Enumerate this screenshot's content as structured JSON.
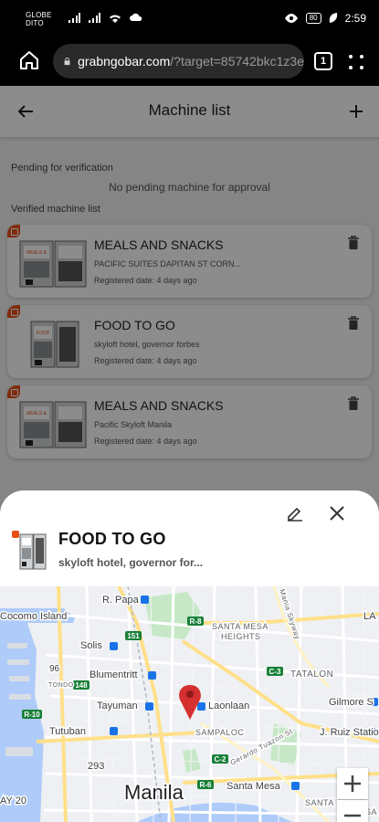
{
  "status_bar": {
    "carrier_line1": "GLOBE",
    "carrier_line2": "DITO",
    "battery": "80",
    "time": "2:59"
  },
  "browser": {
    "url_host": "grabngobar.com",
    "url_rest": "/?target=85742bkc1z3e",
    "tab_count": "1"
  },
  "app_bar": {
    "title": "Machine list"
  },
  "sections": {
    "pending_label": "Pending for verification",
    "pending_empty": "No pending machine for approval",
    "verified_label": "Verified machine list"
  },
  "machines": [
    {
      "name": "MEALS AND SNACKS",
      "address": "PACIFIC SUITES DAPITAN ST CORN...",
      "registered": "Registered date: 4 days ago",
      "thumb_text": "MEALS AND SNACKS"
    },
    {
      "name": "FOOD TO GO",
      "address": "skyloft hotel, governor forbes",
      "registered": "Registered date: 4 days ago",
      "thumb_text": "FOOD TO GO"
    },
    {
      "name": "MEALS AND SNACKS",
      "address": "Pacific Skyloft Manila",
      "registered": "Registered date: 4 days ago",
      "thumb_text": "MEALS AND SNACKS"
    }
  ],
  "sheet": {
    "name": "FOOD TO GO",
    "address": "skyloft hotel, governor for..."
  },
  "map": {
    "labels": {
      "cocomo": "Cocomo Island",
      "rpapa": "R. Papa",
      "solis": "Solis",
      "blumentritt": "Blumentritt",
      "tayuman": "Tayuman",
      "tutuban": "Tutuban",
      "laonlaan": "Laonlaan",
      "sampaloc": "SAMPALOC",
      "santa_mesa_heights": "SANTA MESA",
      "heights": "HEIGHTS",
      "tatalon": "TATALON",
      "gilmore": "Gilmore S",
      "jruiz": "J. Ruiz Station",
      "santa_mesa": "Santa Mesa",
      "manila": "Manila",
      "tondo": "TONDO",
      "n96": "96",
      "n293": "293",
      "y20": "AY 20",
      "santa": "SANTA",
      "gerardo": "Gerardo Tuazon St",
      "mania": "Mania Skyway",
      "r8": "R-8",
      "r10": "R-10",
      "r6": "R-6",
      "c2": "C-2",
      "c3": "C-3",
      "s151": "151",
      "s148": "148",
      "la": "LA",
      "sa": "SA"
    },
    "zoom_in": "+",
    "zoom_out": "−"
  },
  "colors": {
    "accent_orange": "#e8501a",
    "pin_red": "#d3302f",
    "transit_blue": "#1a73e8"
  }
}
